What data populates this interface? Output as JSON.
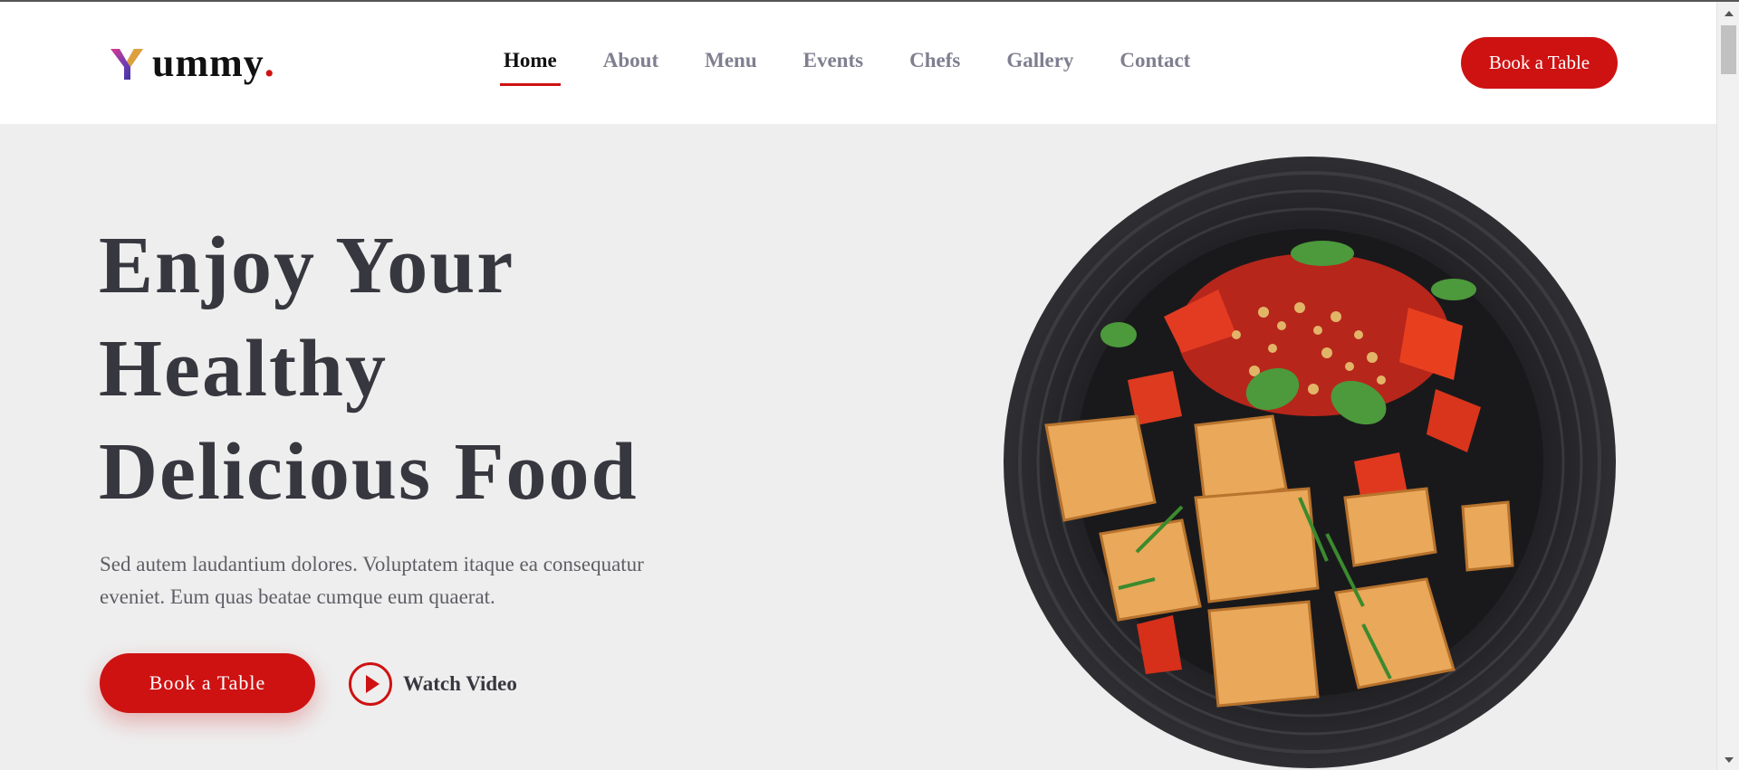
{
  "brand": {
    "logo_text": "ummy",
    "logo_dot": ".",
    "accent_color": "#ce1212"
  },
  "nav": {
    "items": [
      {
        "label": "Home",
        "active": true
      },
      {
        "label": "About",
        "active": false
      },
      {
        "label": "Menu",
        "active": false
      },
      {
        "label": "Events",
        "active": false
      },
      {
        "label": "Chefs",
        "active": false
      },
      {
        "label": "Gallery",
        "active": false
      },
      {
        "label": "Contact",
        "active": false
      }
    ],
    "cta_label": "Book a Table"
  },
  "hero": {
    "title_line1": "Enjoy Your",
    "title_line2": "Healthy",
    "title_line3": "Delicious Food",
    "description_line1": "Sed autem laudantium dolores. Voluptatem itaque ea consequatur",
    "description_line2": "eveniet. Eum quas beatae cumque eum quaerat.",
    "book_label": "Book a Table",
    "watch_label": "Watch Video",
    "image_icon": "food-plate-image"
  },
  "icons": {
    "play": "play-icon",
    "logo": "logo-icon"
  }
}
